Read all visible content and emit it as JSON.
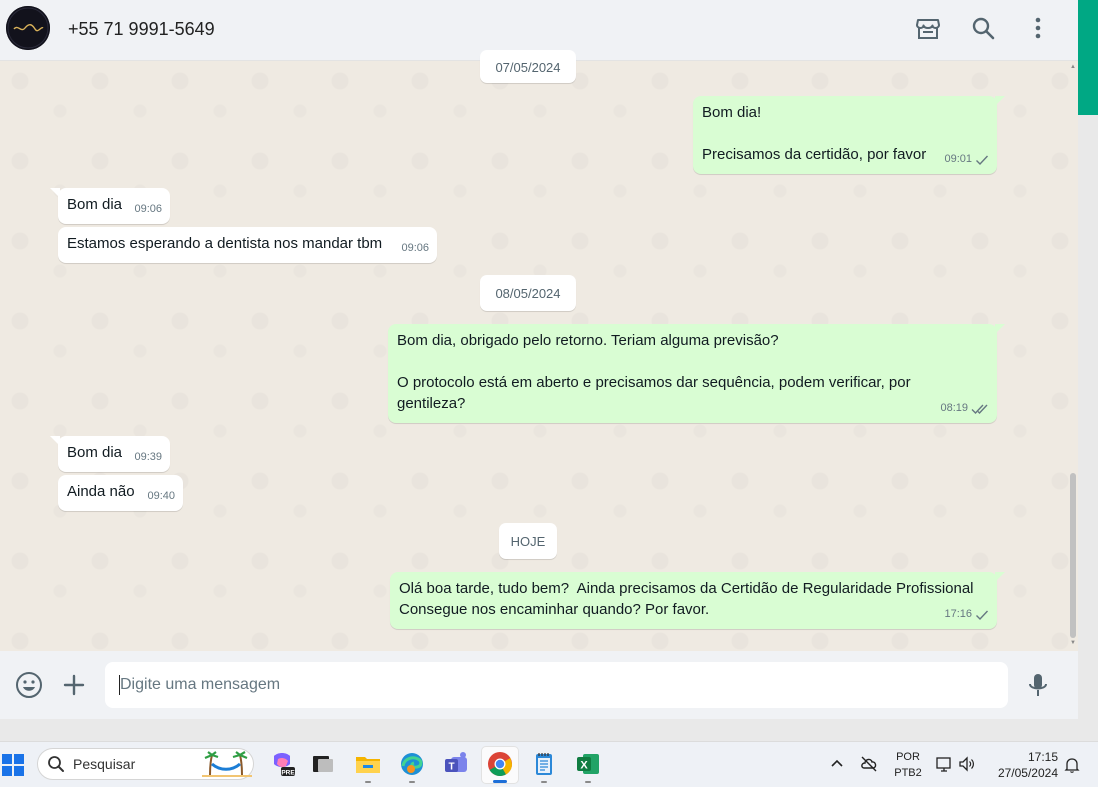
{
  "header": {
    "contact_name": "+55 71 9991-5649",
    "icons": [
      "store-icon",
      "search-icon",
      "menu-dots-icon"
    ]
  },
  "messages": [
    {
      "type": "date",
      "label": "07/05/2024"
    },
    {
      "type": "out",
      "text": "Bom dia!\n\nPrecisamos da certidão, por favor",
      "time": "09:01",
      "status": "sent"
    },
    {
      "type": "in",
      "text": "Bom dia",
      "time": "09:06"
    },
    {
      "type": "in",
      "text": "Estamos esperando a dentista nos mandar tbm",
      "time": "09:06"
    },
    {
      "type": "date",
      "label": "08/05/2024"
    },
    {
      "type": "out",
      "text": "Bom dia, obrigado pelo retorno. Teriam alguma previsão?\n\nO protocolo está em aberto e precisamos dar sequência, podem verificar, por gentileza?",
      "time": "08:19",
      "status": "delivered"
    },
    {
      "type": "in",
      "text": "Bom dia",
      "time": "09:39"
    },
    {
      "type": "in",
      "text": "Ainda não",
      "time": "09:40"
    },
    {
      "type": "date",
      "label": "HOJE"
    },
    {
      "type": "out",
      "text": "Olá boa tarde, tudo bem?  Ainda precisamos da Certidão de Regularidade Profissional\nConsegue nos encaminhar quando? Por favor.",
      "time": "17:16",
      "status": "sent"
    }
  ],
  "composer": {
    "placeholder": "Digite uma mensagem",
    "icons": [
      "emoji-icon",
      "plus-icon",
      "microphone-icon"
    ]
  },
  "taskbar": {
    "search_label": "Pesquisar",
    "lang_top": "POR",
    "lang_bottom": "PTB2",
    "time": "17:15",
    "date": "27/05/2024",
    "pre_badge": "PRE"
  },
  "colors": {
    "chat_bg": "#efeae2",
    "outgoing_bubble": "#d9fdd3",
    "incoming_bubble": "#ffffff",
    "header_bg": "#f0f2f5",
    "accent": "#00a884"
  }
}
